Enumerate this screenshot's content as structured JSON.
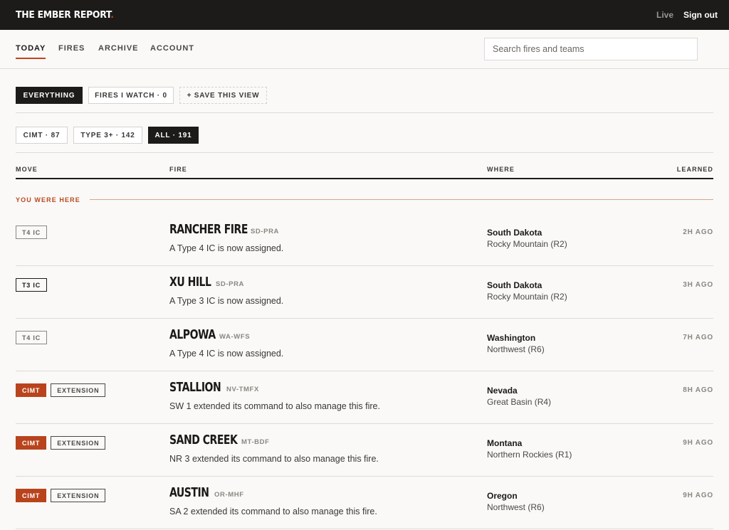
{
  "brand": {
    "name": "THE EMBER REPORT",
    "dot": "."
  },
  "topbar": {
    "live": "Live",
    "signout": "Sign out"
  },
  "nav": {
    "tabs": [
      "TODAY",
      "FIRES",
      "ARCHIVE",
      "ACCOUNT"
    ],
    "active": "TODAY"
  },
  "search": {
    "placeholder": "Search fires and teams",
    "value": ""
  },
  "views": {
    "items": [
      "EVERYTHING",
      "FIRES I WATCH · 0",
      "+ SAVE THIS VIEW"
    ],
    "active": "EVERYTHING"
  },
  "filters": {
    "items": [
      "CIMT · 87",
      "TYPE 3+ · 142",
      "ALL · 191"
    ],
    "active": "ALL · 191"
  },
  "columns": {
    "move": "MOVE",
    "fire": "FIRE",
    "where": "WHERE",
    "learned": "LEARNED"
  },
  "marker": {
    "label": "YOU WERE HERE"
  },
  "rows": [
    {
      "badges": [
        {
          "text": "T4 IC",
          "style": "grey"
        }
      ],
      "name": "RANCHER FIRE",
      "code": "SD-PRA",
      "desc": "A Type 4 IC is now assigned.",
      "state": "South Dakota",
      "region": "Rocky Mountain (R2)",
      "learned": "2H AGO"
    },
    {
      "badges": [
        {
          "text": "T3 IC",
          "style": "black"
        }
      ],
      "name": "XU HILL",
      "code": "SD-PRA",
      "desc": "A Type 3 IC is now assigned.",
      "state": "South Dakota",
      "region": "Rocky Mountain (R2)",
      "learned": "3H AGO"
    },
    {
      "badges": [
        {
          "text": "T4 IC",
          "style": "grey"
        }
      ],
      "name": "ALPOWA",
      "code": "WA-WFS",
      "desc": "A Type 4 IC is now assigned.",
      "state": "Washington",
      "region": "Northwest (R6)",
      "learned": "7H AGO"
    },
    {
      "badges": [
        {
          "text": "CIMT",
          "style": "orange"
        },
        {
          "text": "EXTENSION",
          "style": "outline"
        }
      ],
      "name": "STALLION",
      "code": "NV-TMFX",
      "desc": "SW 1 extended its command to also manage this fire.",
      "state": "Nevada",
      "region": "Great Basin (R4)",
      "learned": "8H AGO"
    },
    {
      "badges": [
        {
          "text": "CIMT",
          "style": "orange"
        },
        {
          "text": "EXTENSION",
          "style": "outline"
        }
      ],
      "name": "SAND CREEK",
      "code": "MT-BDF",
      "desc": "NR 3 extended its command to also manage this fire.",
      "state": "Montana",
      "region": "Northern Rockies (R1)",
      "learned": "9H AGO"
    },
    {
      "badges": [
        {
          "text": "CIMT",
          "style": "orange"
        },
        {
          "text": "EXTENSION",
          "style": "outline"
        }
      ],
      "name": "AUSTIN",
      "code": "OR-MHF",
      "desc": "SA 2 extended its command to also manage this fire.",
      "state": "Oregon",
      "region": "Northwest (R6)",
      "learned": "9H AGO"
    }
  ],
  "colors": {
    "accent": "#c0431a",
    "dark": "#1c1b1a",
    "background": "#faf9f7"
  }
}
